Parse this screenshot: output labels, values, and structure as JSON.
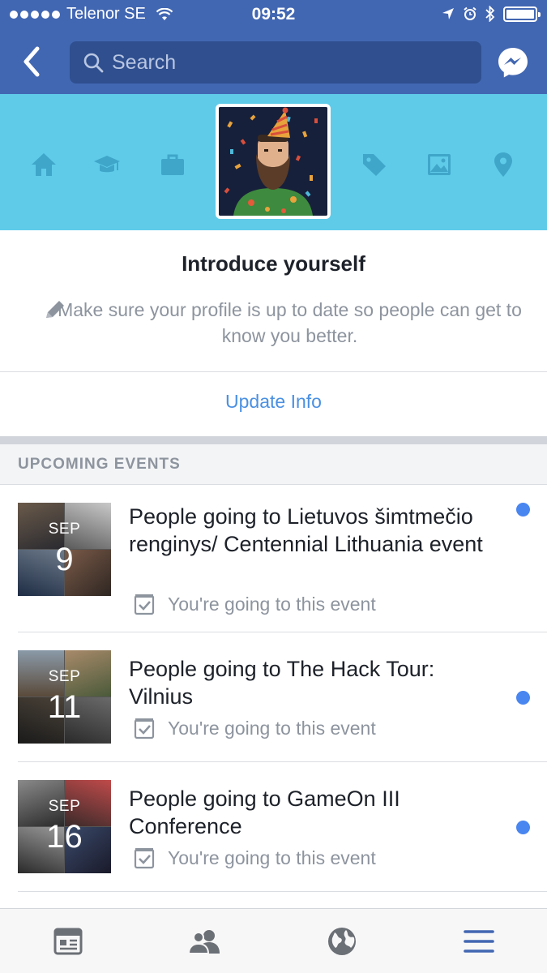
{
  "status_bar": {
    "carrier": "Telenor SE",
    "time": "09:52",
    "battery_level": 1.0
  },
  "nav": {
    "back_icon": "chevron-left-icon",
    "search_placeholder": "Search",
    "messenger_icon": "messenger-icon"
  },
  "cover": {
    "background_color": "#5fcbe9",
    "icons": [
      "home-icon",
      "graduation-cap-icon",
      "briefcase-icon",
      "tag-icon",
      "photo-icon",
      "location-pin-icon"
    ]
  },
  "intro": {
    "title": "Introduce yourself",
    "description": "Make sure your profile is up to date so people can get to know you better.",
    "update_link": "Update Info"
  },
  "events": {
    "header": "UPCOMING EVENTS",
    "items": [
      {
        "month": "SEP",
        "day": "9",
        "title": "People going to Lietuvos šimtmečio renginys/ Centennial Lithuania event",
        "status": "You're going to this event",
        "unread": true
      },
      {
        "month": "SEP",
        "day": "11",
        "title": "People going to The Hack Tour: Vilnius",
        "status": "You're going to this event",
        "unread": true
      },
      {
        "month": "SEP",
        "day": "16",
        "title": "People going to GameOn III Conference",
        "status": "You're going to this event",
        "unread": true
      }
    ]
  },
  "tabbar": {
    "tabs": [
      "news-feed-icon",
      "friends-icon",
      "globe-notifications-icon",
      "menu-icon"
    ],
    "active_tab": "menu-icon",
    "active_color": "#4267b2"
  }
}
